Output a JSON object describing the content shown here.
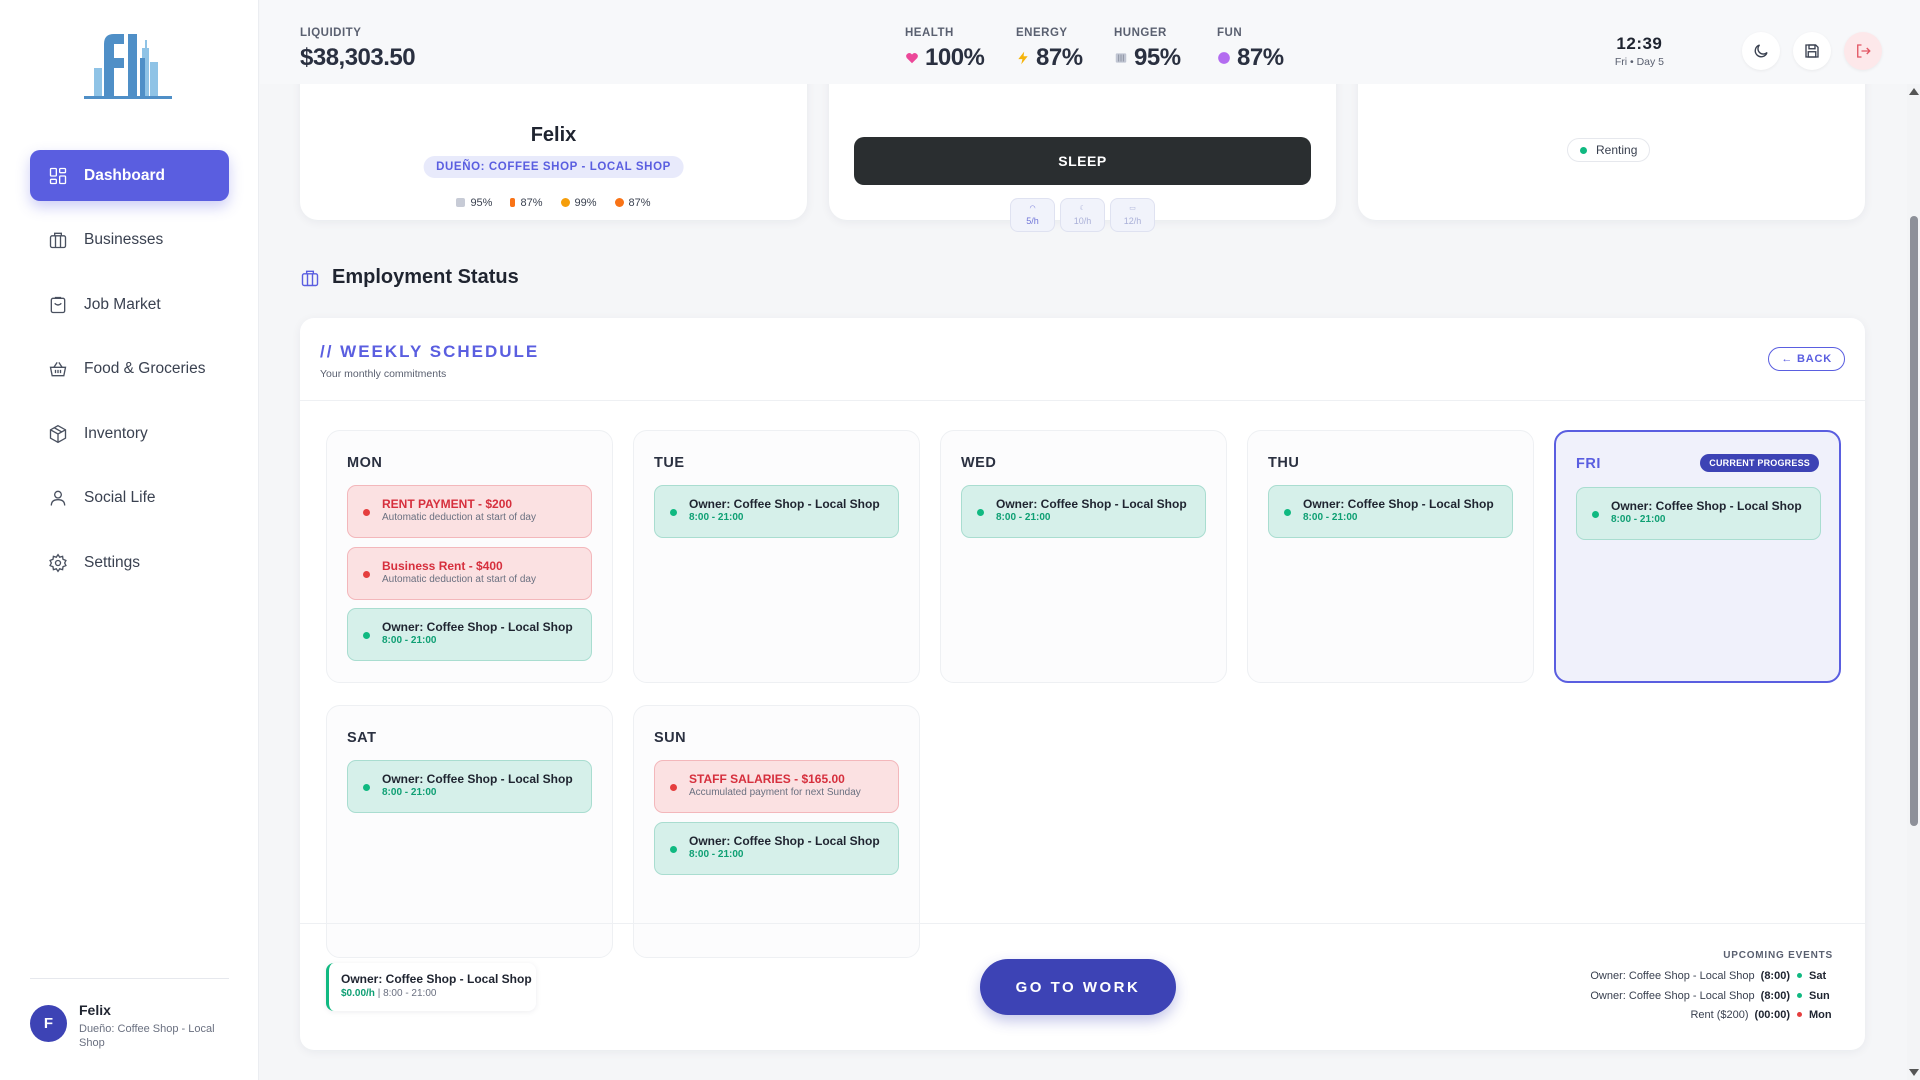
{
  "sidebar": {
    "items": [
      {
        "label": "Dashboard",
        "icon": "dashboard-icon",
        "active": true
      },
      {
        "label": "Businesses",
        "icon": "briefcase-icon"
      },
      {
        "label": "Job Market",
        "icon": "clipboard-icon"
      },
      {
        "label": "Food & Groceries",
        "icon": "basket-icon"
      },
      {
        "label": "Inventory",
        "icon": "box-icon"
      },
      {
        "label": "Social Life",
        "icon": "user-icon"
      },
      {
        "label": "Settings",
        "icon": "gear-icon"
      }
    ],
    "user": {
      "initial": "F",
      "name": "Felix",
      "role": "Dueño: Coffee Shop - Local Shop"
    }
  },
  "topbar": {
    "liquidity_label": "LIQUIDITY",
    "liquidity_value": "$38,303.50",
    "stats": [
      {
        "label": "HEALTH",
        "value": "100%",
        "icon": "heart-icon",
        "color": "#ec4899"
      },
      {
        "label": "ENERGY",
        "value": "87%",
        "icon": "bolt-icon",
        "color": "#f59e0b"
      },
      {
        "label": "HUNGER",
        "value": "95%",
        "icon": "utensils-icon",
        "color": "#94a3b8"
      },
      {
        "label": "FUN",
        "value": "87%",
        "icon": "circle-icon",
        "color": "#a855f7"
      }
    ],
    "time": "12:39",
    "day": "Fri • Day 5"
  },
  "profile": {
    "name": "Felix",
    "role": "DUEÑO: COFFEE SHOP - LOCAL SHOP",
    "mini_stats": [
      "95%",
      "87%",
      "99%",
      "87%"
    ]
  },
  "actions": {
    "sleep_label": "SLEEP",
    "rates": [
      {
        "top": "5/h",
        "active": true
      },
      {
        "top": "10/h",
        "active": false
      },
      {
        "top": "12/h",
        "active": false
      }
    ]
  },
  "housing": {
    "status": "Renting"
  },
  "employment": {
    "title": "Employment Status",
    "schedule_title": "// WEEKLY SCHEDULE",
    "schedule_subtitle": "Your monthly commitments",
    "back_label": "← BACK",
    "current_badge": "CURRENT PROGRESS",
    "days": [
      {
        "name": "MON",
        "events": [
          {
            "type": "bill",
            "title": "RENT PAYMENT - $200",
            "sub": "Automatic deduction at start of day"
          },
          {
            "type": "bill",
            "title": "Business Rent - $400",
            "sub": "Automatic deduction at start of day"
          },
          {
            "type": "work",
            "title": "Owner: Coffee Shop - Local Shop",
            "sub": "8:00 - 21:00"
          }
        ]
      },
      {
        "name": "TUE",
        "events": [
          {
            "type": "work",
            "title": "Owner: Coffee Shop - Local Shop",
            "sub": "8:00 - 21:00"
          }
        ]
      },
      {
        "name": "WED",
        "events": [
          {
            "type": "work",
            "title": "Owner: Coffee Shop - Local Shop",
            "sub": "8:00 - 21:00"
          }
        ]
      },
      {
        "name": "THU",
        "events": [
          {
            "type": "work",
            "title": "Owner: Coffee Shop - Local Shop",
            "sub": "8:00 - 21:00"
          }
        ]
      },
      {
        "name": "FRI",
        "today": true,
        "events": [
          {
            "type": "work",
            "title": "Owner: Coffee Shop - Local Shop",
            "sub": "8:00 - 21:00"
          }
        ]
      },
      {
        "name": "SAT",
        "events": [
          {
            "type": "work",
            "title": "Owner: Coffee Shop - Local Shop",
            "sub": "8:00 - 21:00"
          }
        ]
      },
      {
        "name": "SUN",
        "events": [
          {
            "type": "bill",
            "title": "STAFF SALARIES - $165.00",
            "sub": "Accumulated payment for next Sunday"
          },
          {
            "type": "work",
            "title": "Owner: Coffee Shop - Local Shop",
            "sub": "8:00 - 21:00"
          }
        ]
      }
    ],
    "current_job": {
      "title": "Owner: Coffee Shop - Local Shop",
      "wage": "$0.00/h",
      "hours": " | 8:00 - 21:00"
    },
    "go_label": "GO TO WORK",
    "upcoming_label": "UPCOMING EVENTS",
    "upcoming": [
      {
        "name": "Owner: Coffee Shop - Local Shop",
        "time": "(8:00)",
        "type": "work",
        "day": "Sat"
      },
      {
        "name": "Owner: Coffee Shop - Local Shop",
        "time": "(8:00)",
        "type": "work",
        "day": "Sun"
      },
      {
        "name": "Rent ($200)",
        "time": "(00:00)",
        "type": "bill",
        "day": "Mon"
      }
    ]
  }
}
